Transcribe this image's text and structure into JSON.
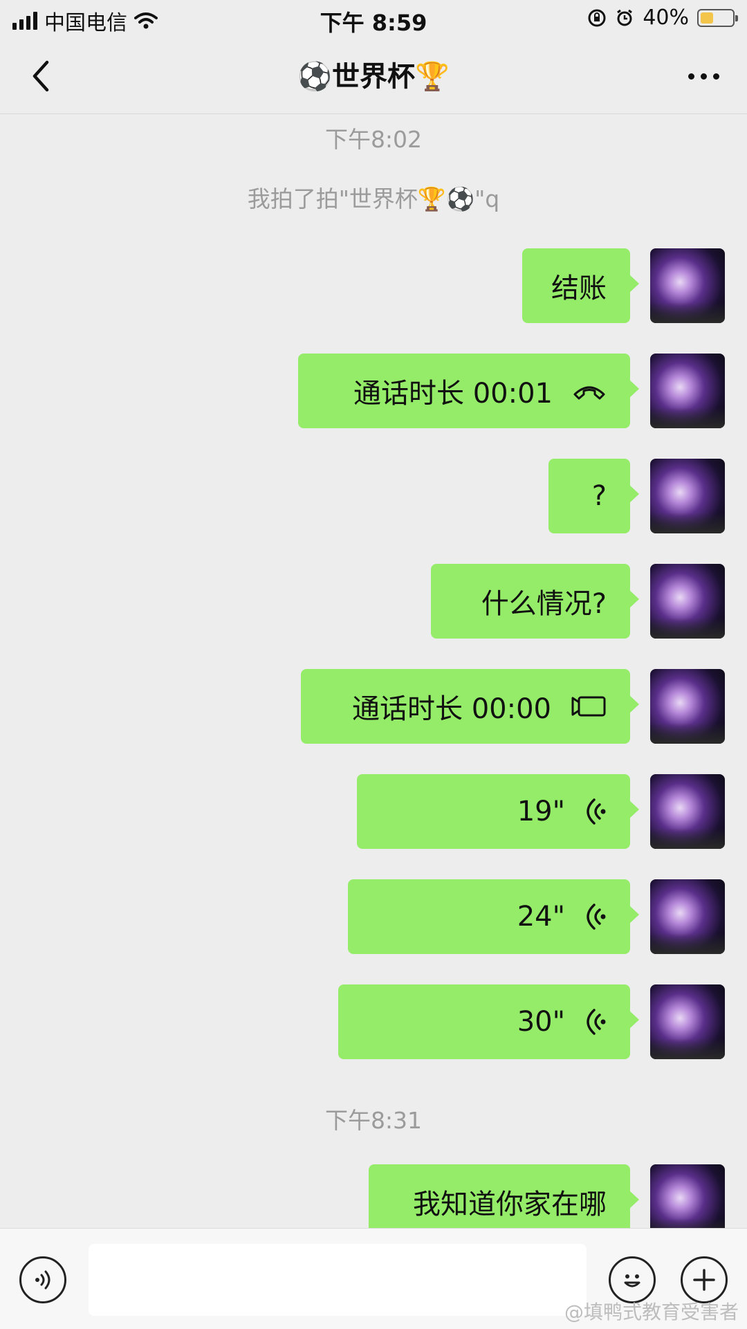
{
  "status_bar": {
    "carrier": "中国电信",
    "time": "下午 8:59",
    "battery": "40%",
    "battery_level": 0.4
  },
  "nav": {
    "title": "⚽世界杯🏆"
  },
  "chat": {
    "time_1": "下午8:02",
    "system_message": "我拍了拍\"世界杯🏆⚽\"q",
    "messages": [
      {
        "text": "结账",
        "icon": ""
      },
      {
        "text": "通话时长 00:01",
        "icon": "phone-icon"
      },
      {
        "text": "?",
        "icon": ""
      },
      {
        "text": "什么情况?",
        "icon": ""
      },
      {
        "text": "通话时长 00:00",
        "icon": "video-icon"
      },
      {
        "text": "19\"",
        "icon": "voice-icon",
        "duration_seconds": 19
      },
      {
        "text": "24\"",
        "icon": "voice-icon",
        "duration_seconds": 24
      },
      {
        "text": "30\"",
        "icon": "voice-icon",
        "duration_seconds": 30
      }
    ],
    "time_2": "下午8:31",
    "last_message": "我知道你家在哪"
  },
  "input": {
    "value": ""
  },
  "watermark": "@填鸭式教育受害者",
  "colors": {
    "bubble": "#95ec69",
    "background": "#ededed",
    "bottom_bar": "#f7f7f7"
  }
}
